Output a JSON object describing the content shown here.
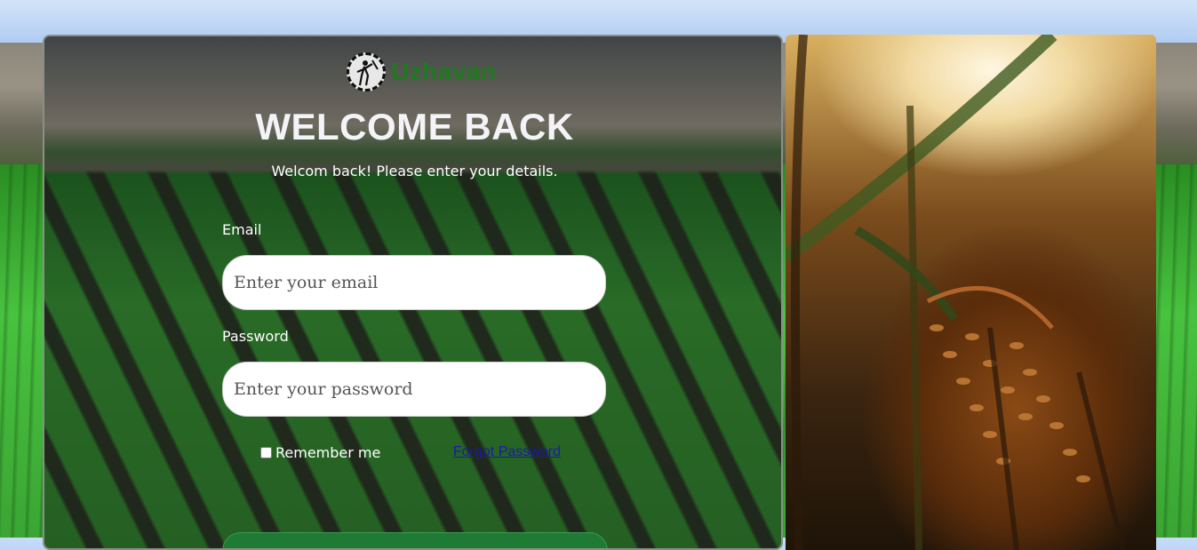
{
  "brand": {
    "name": "Uzhavan",
    "color": "#1f7a1f"
  },
  "login": {
    "title": "WELCOME BACK",
    "subtitle": "Welcom back! Please enter your details.",
    "email_label": "Email",
    "email_placeholder": "Enter your email",
    "password_label": "Password",
    "password_placeholder": "Enter your password",
    "remember_label": "Remember me",
    "forgot_label": "Forgot Password"
  },
  "icons": {
    "logo": "farmer-logo-icon"
  },
  "colors": {
    "link": "#1a1aa8",
    "button": "#1e7a35",
    "headline": "#f4f4f8"
  }
}
